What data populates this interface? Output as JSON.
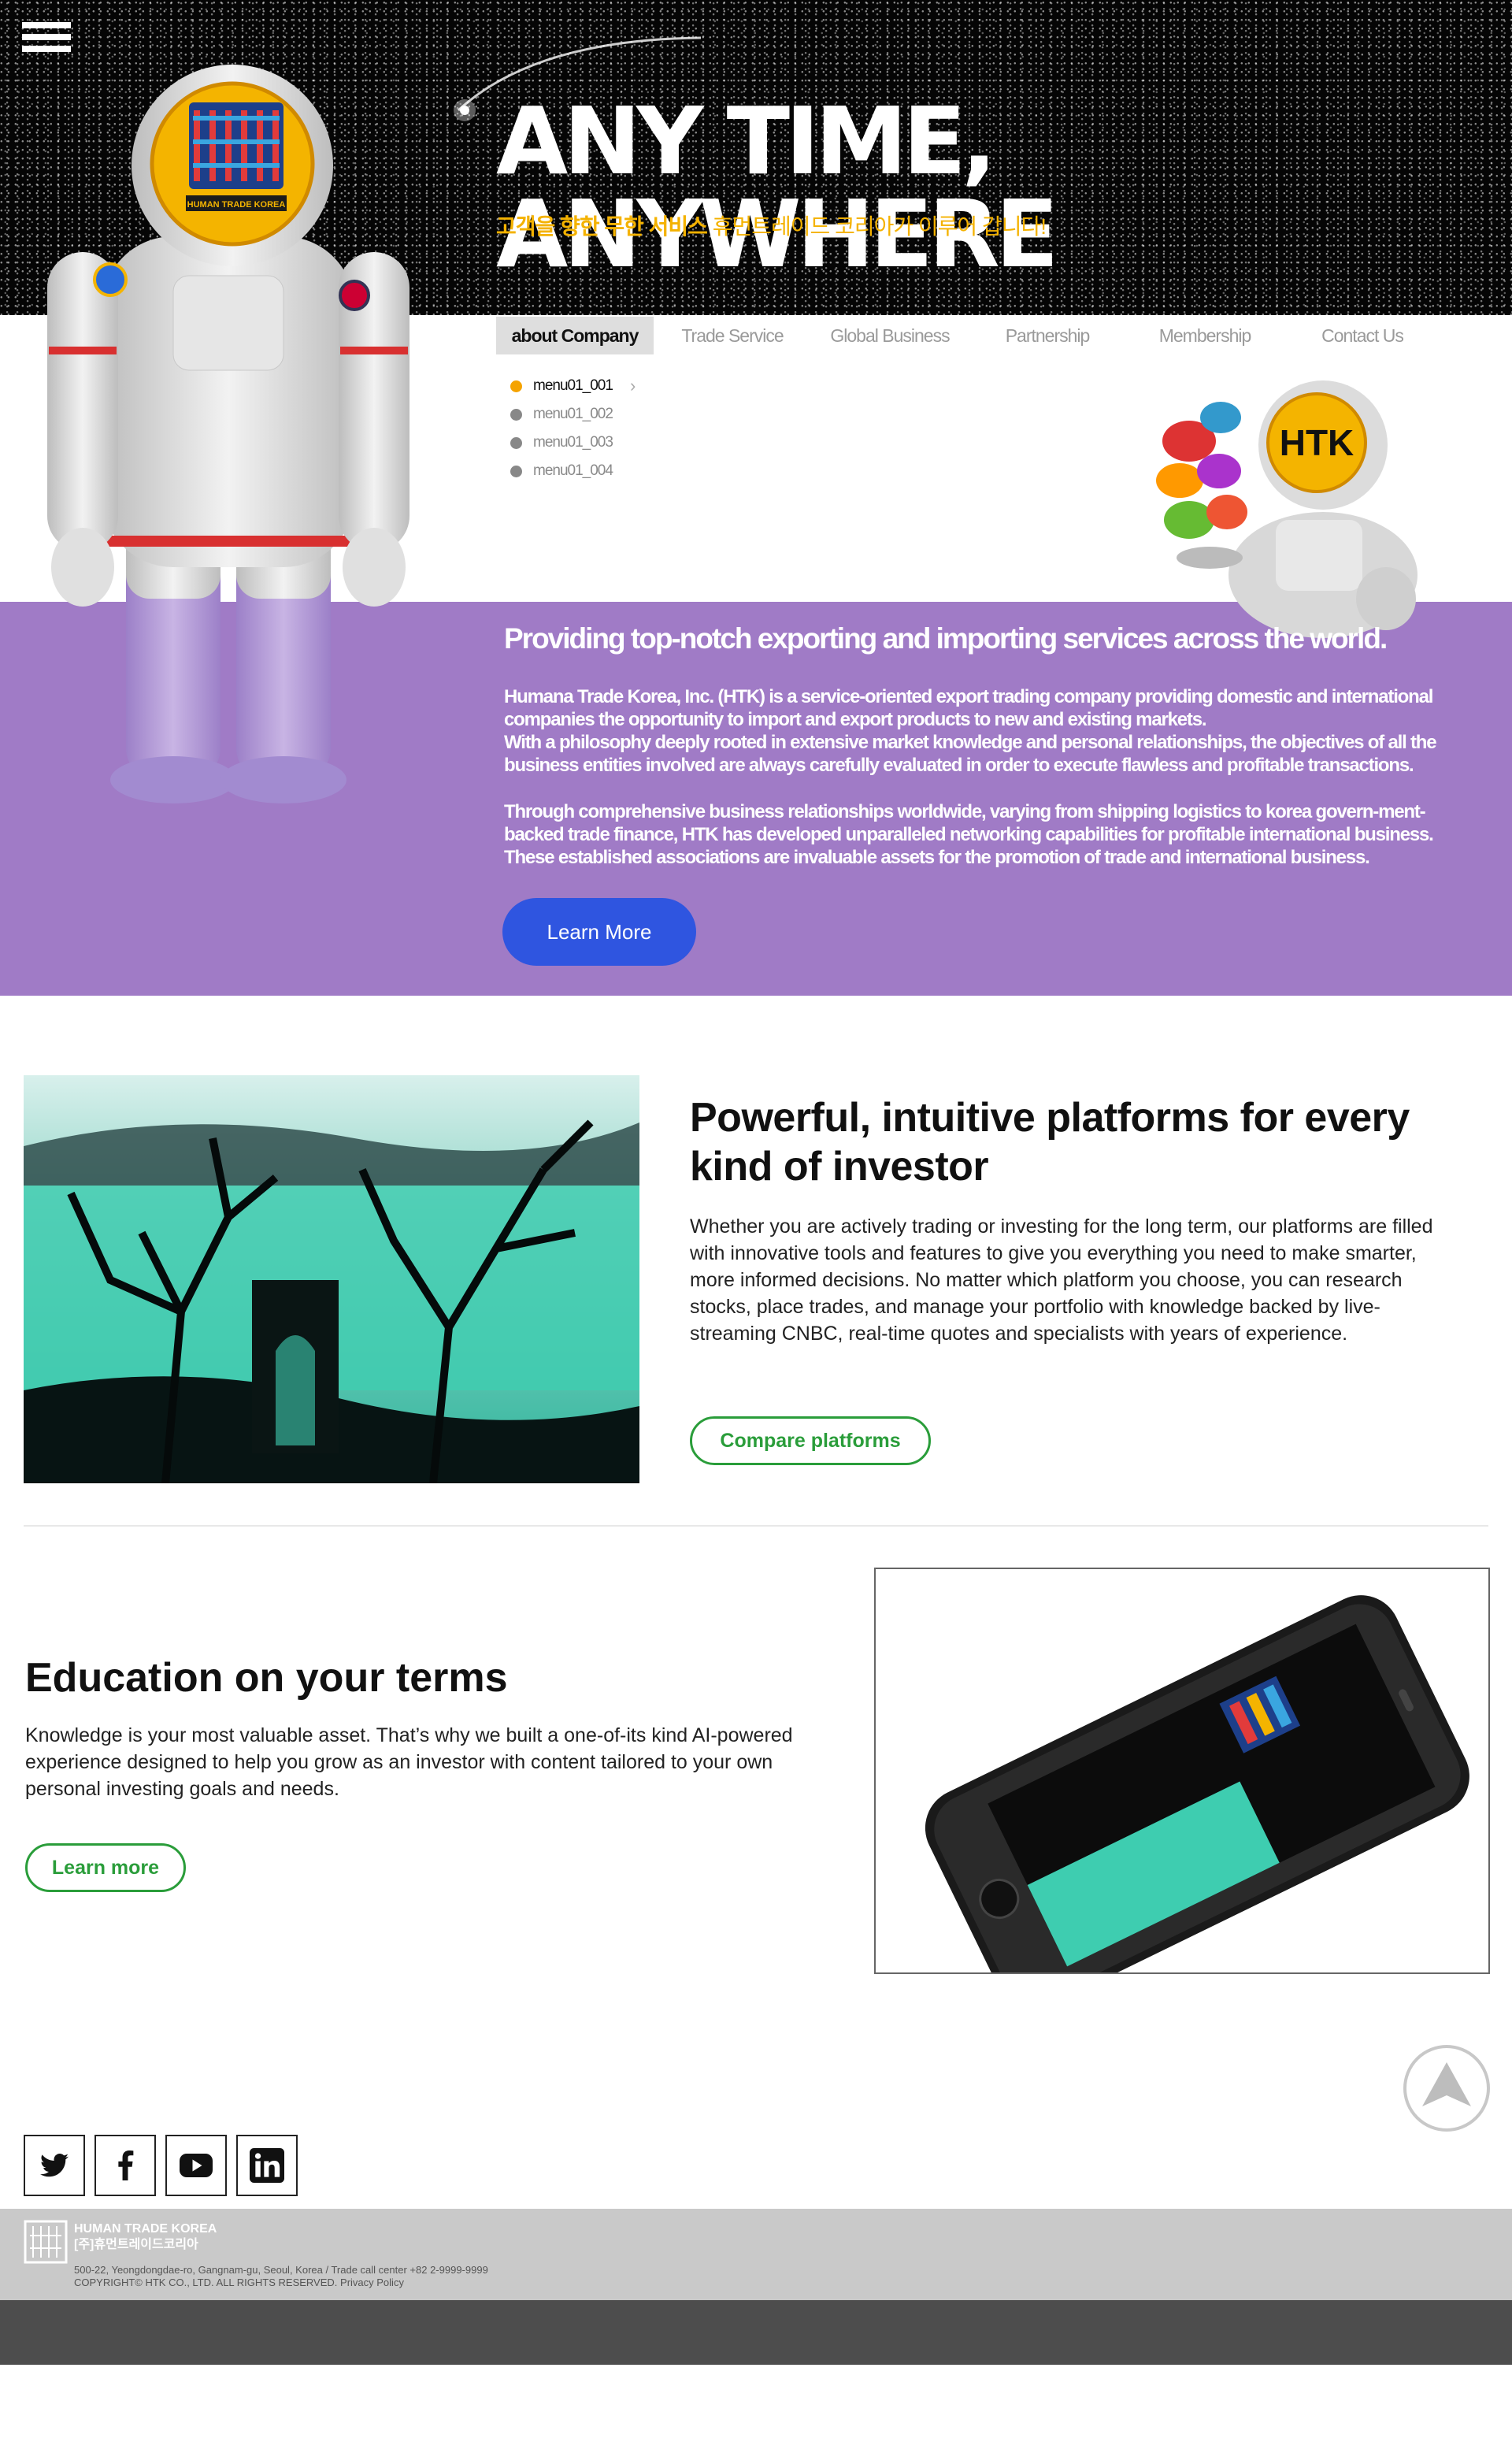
{
  "colors": {
    "accent_yellow": "#f4b200",
    "purple": "#a07bc6",
    "button_blue": "#2f55e0",
    "green": "#2a9d3a"
  },
  "hero": {
    "title": "ANY TIME, ANYWHERE",
    "sub_bold": "고객을 향한 무한 서비스",
    "sub_rest": " 휴먼트레이드 코리아가 이루어 갑니다!",
    "logo_text": "HUMAN TRADE KOREA",
    "small_logo_text": "HTK"
  },
  "nav": {
    "items": [
      "about Company",
      "Trade Service",
      "Global Business",
      "Partnership",
      "Membership",
      "Contact Us"
    ],
    "active": "about Company"
  },
  "submenu": {
    "items": [
      "menu01_001",
      "menu01_002",
      "menu01_003",
      "menu01_004"
    ],
    "active": "menu01_001"
  },
  "about": {
    "heading": "Providing top-notch exporting and importing services across the world.",
    "p1": "Humana Trade Korea, Inc. (HTK) is a service-oriented export trading company providing domestic and international companies the opportunity to import and export products to new and existing markets.",
    "p2": "With a philosophy deeply rooted in extensive market knowledge and personal relationships, the objectives of all the business entities involved are always carefully evaluated in order to execute flawless and profitable transactions.",
    "p3": "Through comprehensive business relationships worldwide, varying from shipping logistics to korea govern-ment-backed trade finance, HTK has developed unparalleled networking capabilities for profitable international business. These established associations are invaluable assets for the promotion of trade and international business.",
    "button": "Learn More"
  },
  "platforms": {
    "title": "Powerful, intuitive platforms for every kind of investor",
    "desc": "Whether you are actively trading or investing for the long term, our platforms are filled with innovative tools and features to give you everything you need to make smarter, more informed decisions. No matter which platform you choose, you can research stocks, place trades, and manage your portfolio with knowledge backed by live-streaming CNBC, real-time quotes and specialists with years of experience.",
    "button": "Compare platforms"
  },
  "education": {
    "title": "Education on your terms",
    "desc": "Knowledge is your most valuable asset. That’s why we built a one-of-its kind AI-powered experience designed to help you grow as an investor with content tailored to your own personal investing goals and needs.",
    "button": "Learn more"
  },
  "social": [
    "twitter-icon",
    "facebook-icon",
    "youtube-icon",
    "linkedin-icon"
  ],
  "footer": {
    "brand_en": "HUMAN TRADE KOREA",
    "brand_kr": "[주]휴먼트레이드코리아",
    "address": "500-22, Yeongdongdae-ro, Gangnam-gu, Seoul, Korea / Trade call center +82 2-9999-9999",
    "copyright": "COPYRIGHT© HTK CO., LTD. ALL RIGHTS RESERVED.",
    "privacy": "Privacy Policy"
  }
}
